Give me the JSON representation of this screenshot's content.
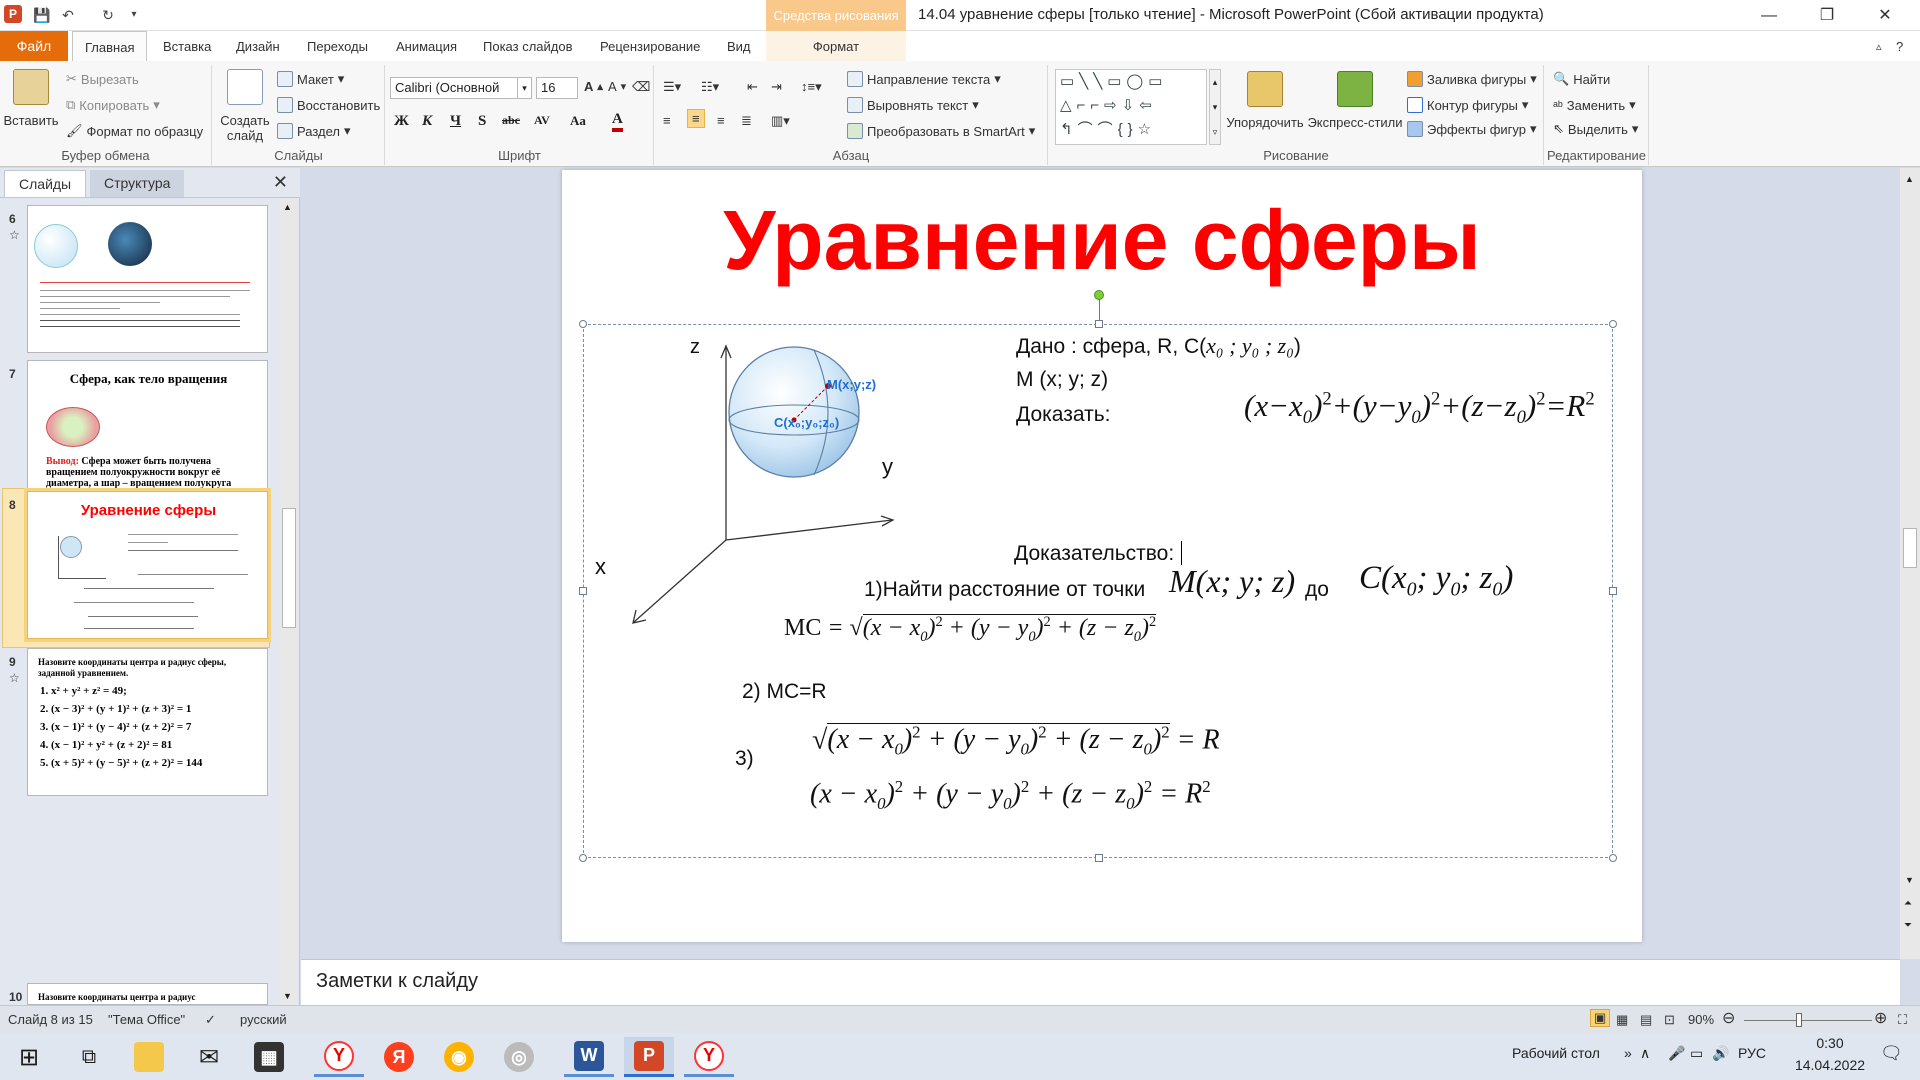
{
  "window": {
    "title": "14.04 уравнение сферы [только чтение]  -  Microsoft PowerPoint (Сбой активации продукта)",
    "context_tab_header": "Средства рисования",
    "minimize": "—",
    "maximize": "❐",
    "close": "✕"
  },
  "tabs": {
    "file": "Файл",
    "items": [
      "Главная",
      "Вставка",
      "Дизайн",
      "Переходы",
      "Анимация",
      "Показ слайдов",
      "Рецензирование",
      "Вид"
    ],
    "format": "Формат"
  },
  "ribbon": {
    "clipboard": {
      "paste": "Вставить",
      "cut": "Вырезать",
      "copy": "Копировать",
      "format_painter": "Формат по образцу",
      "label": "Буфер обмена"
    },
    "slides": {
      "new_slide": "Создать слайд",
      "layout": "Макет",
      "reset": "Восстановить",
      "section": "Раздел",
      "label": "Слайды"
    },
    "font": {
      "name": "Calibri (Основной",
      "size": "16",
      "bold": "Ж",
      "italic": "К",
      "underline": "Ч",
      "shadow": "S",
      "strike": "abc",
      "spacing": "AV",
      "case": "Aa",
      "color": "A",
      "label": "Шрифт"
    },
    "paragraph": {
      "text_direction": "Направление текста",
      "align_text": "Выровнять текст",
      "smartart": "Преобразовать в SmartArt",
      "label": "Абзац"
    },
    "drawing": {
      "arrange": "Упорядочить",
      "quick_styles": "Экспресс-стили",
      "shape_fill": "Заливка фигуры",
      "shape_outline": "Контур фигуры",
      "shape_effects": "Эффекты фигур",
      "label": "Рисование"
    },
    "editing": {
      "find": "Найти",
      "replace": "Заменить",
      "select": "Выделить",
      "label": "Редактирование"
    }
  },
  "panel": {
    "tab_slides": "Слайды",
    "tab_outline": "Структура",
    "close": "✕",
    "thumbs": [
      {
        "num": "6"
      },
      {
        "num": "7",
        "title": "Сфера, как тело вращения",
        "conclusion_label": "Вывод:",
        "conclusion": "Сфера может быть получена вращением полуокружности вокруг её диаметра, а шар – вращением полукруга вокруг его диаметра."
      },
      {
        "num": "8",
        "title": "Уравнение сферы"
      },
      {
        "num": "9",
        "title": "Назовите координаты центра и радиус сферы, заданной уравнением.",
        "items": [
          "1. x² + y² + z² = 49;",
          "2. (x − 3)² + (y + 1)² + (z + 3)² = 1",
          "3. (x − 1)² + (y − 4)² + (z + 2)² = 7",
          "4. (x − 1)² + y² + (z + 2)² = 81",
          "5. (x + 5)² + (y − 5)² + (z + 2)² = 144"
        ]
      },
      {
        "num": "10",
        "title": "Назовите координаты центра и радиус"
      }
    ]
  },
  "slide": {
    "title": "Уравнение сферы",
    "axis_z": "z",
    "axis_y": "y",
    "axis_x": "x",
    "point_m": "M(x;y;z)",
    "point_c": "C(x₀;y₀;z₀)",
    "given_line": "Дано : сфера, R, C(",
    "given_coords": "x₀ ; y₀ ; z₀",
    "given_close": ")",
    "m_line": "M (x; y; z)",
    "prove": "Доказать:",
    "proof": "Доказательство:",
    "step1_text": "1)Найти расстояние от точки",
    "step1_to": "до",
    "step2": "2) MC=R",
    "step3": "3)"
  },
  "notes": {
    "placeholder": "Заметки к слайду"
  },
  "status": {
    "slide_of": "Слайд 8 из 15",
    "theme": "\"Тема Office\"",
    "language": "русский",
    "zoom": "90%"
  },
  "taskbar": {
    "desktop_label": "Рабочий стол",
    "lang": "РУС",
    "time": "0:30",
    "date": "14.04.2022"
  },
  "colors": {
    "title_red": "#ff0000",
    "file_tab": "#e46c0a",
    "context_tab": "#f9c98b",
    "point_label": "#1f6fd0"
  }
}
